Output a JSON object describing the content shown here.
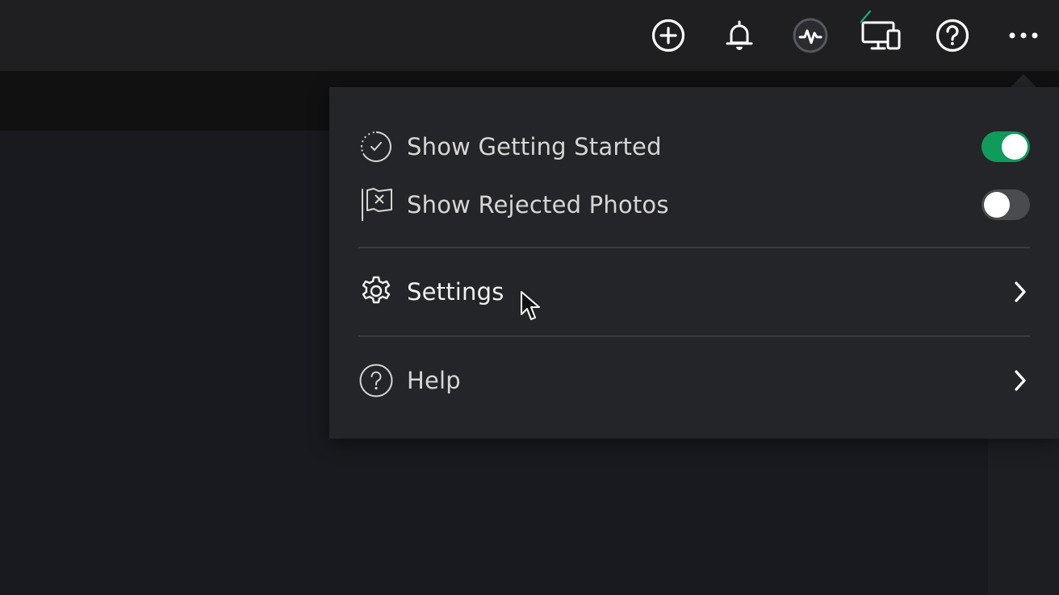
{
  "topbar": {
    "icons": [
      "add-circle-icon",
      "bell-icon",
      "activity-icon",
      "devices-icon",
      "help-circle-icon",
      "more-icon"
    ]
  },
  "menu": {
    "items": [
      {
        "label": "Show Getting Started",
        "icon": "getting-started-icon",
        "toggle": true
      },
      {
        "label": "Show Rejected Photos",
        "icon": "rejected-flag-icon",
        "toggle": false
      },
      {
        "label": "Settings",
        "icon": "gear-icon"
      },
      {
        "label": "Help",
        "icon": "help-icon"
      }
    ]
  },
  "colors": {
    "toggle_on": "#0f9b5a",
    "toggle_off": "#4a4b4f",
    "sync_check": "#1fae72"
  }
}
